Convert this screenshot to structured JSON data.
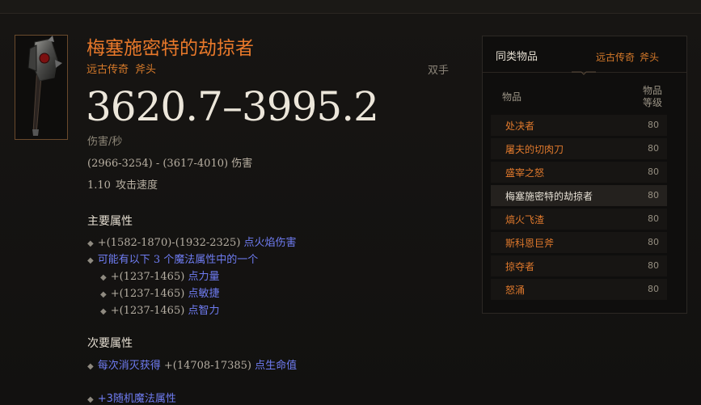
{
  "item": {
    "name": "梅塞施密特的劫掠者",
    "rarity": "远古传奇",
    "type": "斧头",
    "handed": "双手",
    "dps": "3620.7–3995.2",
    "dps_label": "伤害/秒",
    "damage_range": "(2966-3254) - (3617-4010)",
    "damage_label": "伤害",
    "attack_speed": "1.10",
    "attack_speed_label": "攻击速度"
  },
  "primary": {
    "heading": "主要属性",
    "fire": {
      "value": "+(1582-1870)-(1932-2325)",
      "label": "点火焰伤害"
    },
    "choose": {
      "prefix": "可能有以下",
      "count": "3",
      "suffix": "个魔法属性中的一个"
    },
    "options": [
      {
        "value": "+(1237-1465)",
        "label": "点力量"
      },
      {
        "value": "+(1237-1465)",
        "label": "点敏捷"
      },
      {
        "value": "+(1237-1465)",
        "label": "点智力"
      }
    ]
  },
  "secondary": {
    "heading": "次要属性",
    "life": {
      "prefix": "每次消灭获得",
      "value": "+(14708-17385)",
      "label": "点生命值"
    }
  },
  "random": {
    "label": "+3随机魔法属性"
  },
  "panel": {
    "title": "同类物品",
    "rarity": "远古传奇",
    "type": "斧头",
    "col_item": "物品",
    "col_level_line1": "物品",
    "col_level_line2": "等级",
    "rows": [
      {
        "name": "处决者",
        "level": "80"
      },
      {
        "name": "屠夫的切肉刀",
        "level": "80"
      },
      {
        "name": "盛宰之怒",
        "level": "80"
      },
      {
        "name": "梅塞施密特的劫掠者",
        "level": "80"
      },
      {
        "name": "熇火飞渣",
        "level": "80"
      },
      {
        "name": "斯科恩巨斧",
        "level": "80"
      },
      {
        "name": "掠夺者",
        "level": "80"
      },
      {
        "name": "怒涌",
        "level": "80"
      }
    ]
  },
  "colors": {
    "legendary_orange": "#e8782a",
    "magic_blue": "#6f7cf2",
    "background": "#141210"
  }
}
